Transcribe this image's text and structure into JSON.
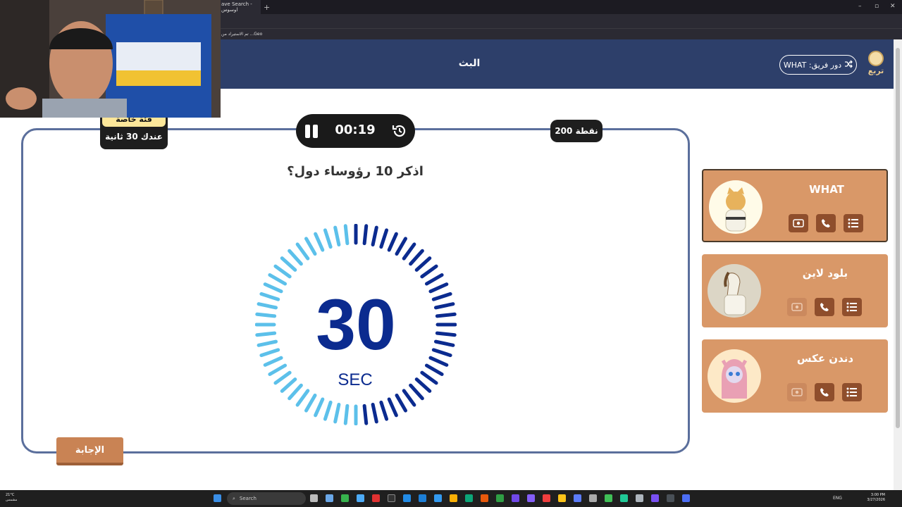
{
  "browser": {
    "tab_title": "ave Search - اوسوس",
    "new_tab_label": "+",
    "bookmark_1": "تم الاستيراد من ...Geo",
    "win_min": "–",
    "win_max": "▫",
    "win_close": "✕"
  },
  "header": {
    "title": "البث",
    "turn_label": "دور فريق: WHAT",
    "turn_icon": "shuffle-icon",
    "logo_text": "تربع"
  },
  "question_card": {
    "points": "200 نقطة",
    "timer": "00:19",
    "category_title": "فئة خاصة",
    "category_time": "عندك 30 ثانية",
    "question": "اذكر 10 رؤوساء دول؟",
    "answer_button": "الإجابة"
  },
  "countdown": {
    "value": "30",
    "unit": "SEC",
    "colors": {
      "dark": "#0b2b8f",
      "light": "#5cc0ea"
    }
  },
  "teams": [
    {
      "name": "WHAT",
      "active": true,
      "avatar": "cat-karate-avatar",
      "actions": [
        "swap-icon",
        "phone-icon",
        "list-icon"
      ],
      "disabled": []
    },
    {
      "name": "بلود لاين",
      "active": false,
      "avatar": "horse-avatar",
      "actions": [
        "swap-icon",
        "phone-icon",
        "list-icon"
      ],
      "disabled": [
        "swap-icon"
      ]
    },
    {
      "name": "دندن عكس",
      "active": false,
      "avatar": "cat-hijab-avatar",
      "actions": [
        "swap-icon",
        "phone-icon",
        "list-icon"
      ],
      "disabled": [
        "swap-icon"
      ]
    }
  ],
  "taskbar": {
    "search_label": "Search",
    "weather_temp": "21°C",
    "weather_desc": "مشمس",
    "lang": "ENG",
    "time": "3:00 PM",
    "date": "3/27/2026"
  },
  "theme": {
    "header_bg": "#2d3f6a",
    "card_border": "#5b6f9c",
    "team_bg": "#d99868",
    "action_bg": "#8f4e2c",
    "answer_bg": "#c98354"
  }
}
